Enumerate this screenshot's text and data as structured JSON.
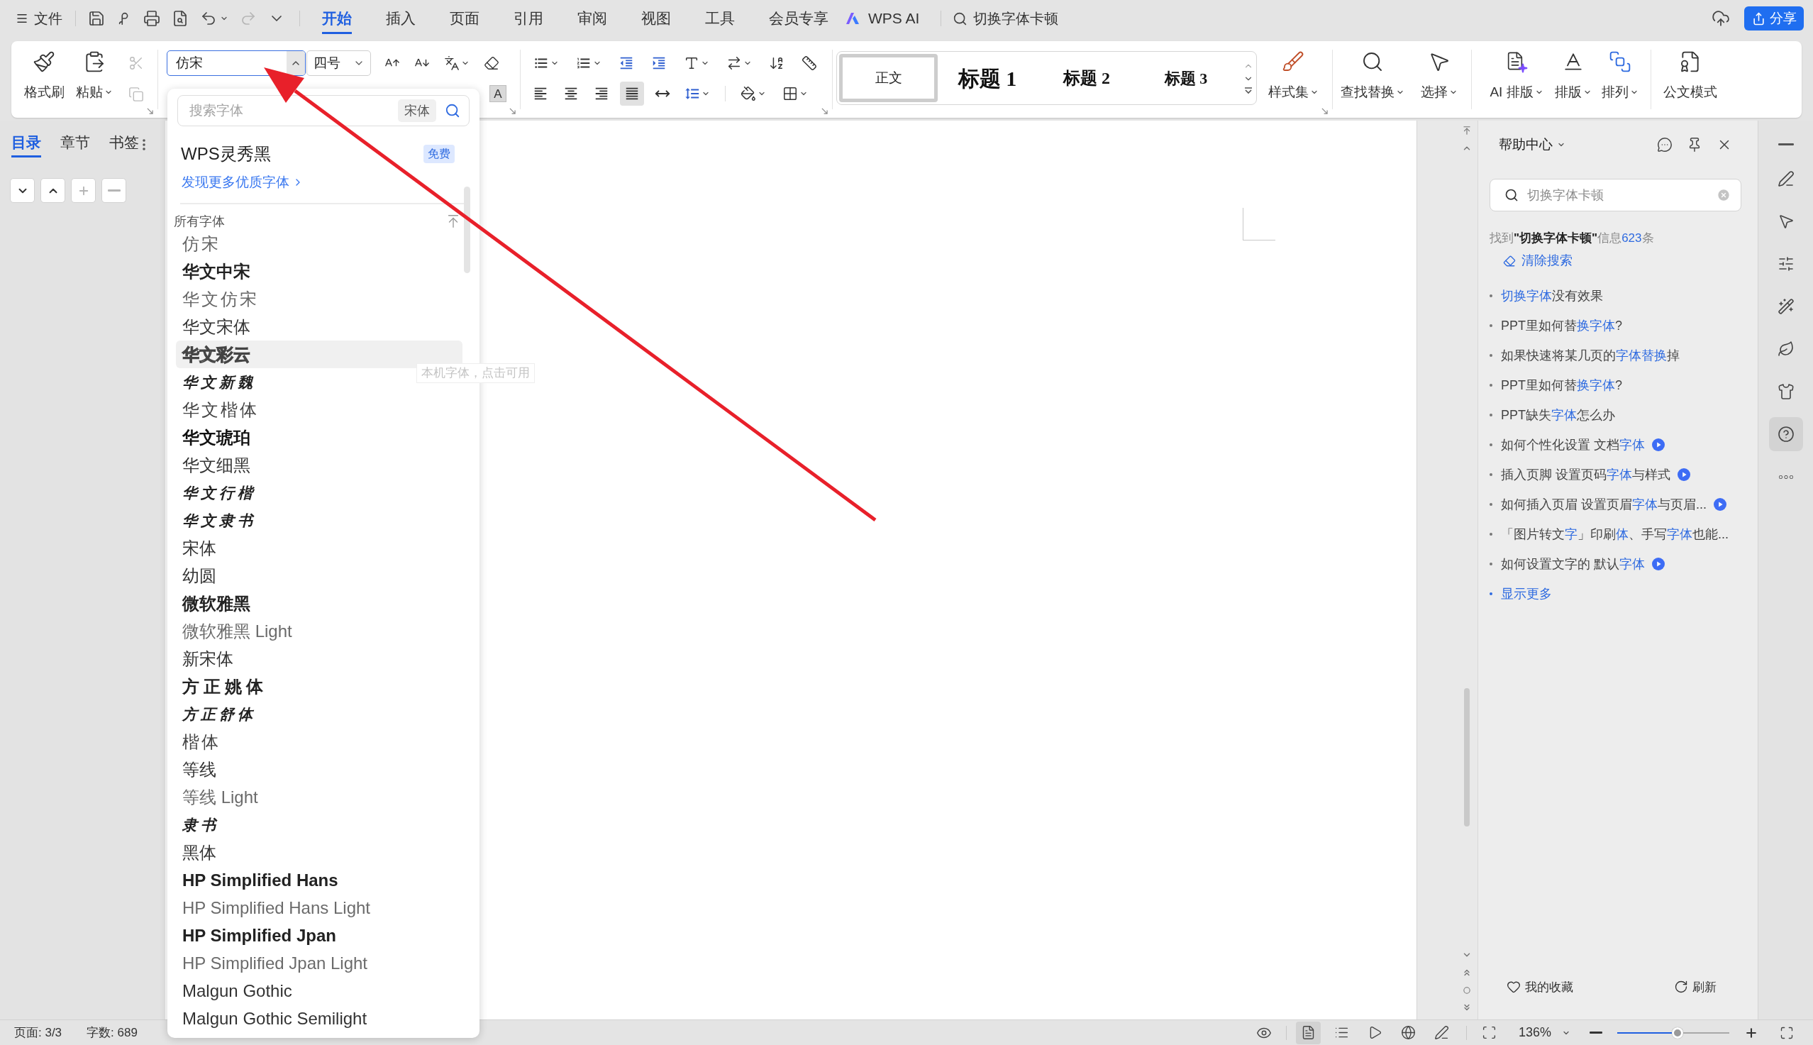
{
  "menu_bar": {
    "file_menu": "文件",
    "quick_access": [
      {
        "kind": "save",
        "disabled": false
      },
      {
        "kind": "export",
        "disabled": false
      },
      {
        "kind": "print",
        "disabled": false
      },
      {
        "kind": "preview",
        "disabled": false
      },
      {
        "kind": "undo",
        "disabled": false
      },
      {
        "kind": "redo",
        "disabled": true
      },
      {
        "kind": "more",
        "disabled": false
      }
    ],
    "tabs": [
      {
        "label": "开始",
        "selected": true
      },
      {
        "label": "插入",
        "selected": false
      },
      {
        "label": "页面",
        "selected": false
      },
      {
        "label": "引用",
        "selected": false
      },
      {
        "label": "审阅",
        "selected": false
      },
      {
        "label": "视图",
        "selected": false
      },
      {
        "label": "工具",
        "selected": false
      },
      {
        "label": "会员专享",
        "selected": false
      }
    ],
    "ai_tab": "WPS AI",
    "search": {
      "value": "切换字体卡顿"
    },
    "share_button": "分享"
  },
  "ribbon": {
    "clipboard": {
      "buttons": [
        {
          "kind": "format_painter",
          "label": "格式刷",
          "dropdown": false
        },
        {
          "kind": "paste",
          "label": "粘贴",
          "dropdown": true
        }
      ],
      "tools": [
        {
          "kind": "cut",
          "disabled": true
        },
        {
          "kind": "copy",
          "disabled": true
        }
      ]
    },
    "font": {
      "name": {
        "value": "仿宋",
        "expanded": true
      },
      "size": {
        "value": "四号"
      },
      "shading_label": "A"
    },
    "paragraph": {
      "align_buttons": [
        {
          "kind": "left",
          "selected": false
        },
        {
          "kind": "center",
          "selected": false
        },
        {
          "kind": "right",
          "selected": false
        },
        {
          "kind": "justify",
          "selected": true
        },
        {
          "kind": "distributed",
          "selected": false
        }
      ]
    },
    "styles": {
      "items": [
        {
          "kind": "body",
          "label": "正文",
          "selected": true
        },
        {
          "kind": "heading1",
          "label": "标题 1",
          "selected": false
        },
        {
          "kind": "heading2",
          "label": "标题 2",
          "selected": false
        },
        {
          "kind": "heading3",
          "label": "标题 3",
          "selected": false
        }
      ],
      "style_set": {
        "kind": "style_set",
        "label": "样式集",
        "dropdown": true
      }
    },
    "editing": [
      {
        "kind": "find_replace",
        "label": "查找替换",
        "dropdown": true
      },
      {
        "kind": "select",
        "label": "选择",
        "dropdown": true
      }
    ],
    "layout": [
      {
        "kind": "ai_layout",
        "label": "AI 排版",
        "dropdown": true
      },
      {
        "kind": "typesetting",
        "label": "排版",
        "dropdown": true
      },
      {
        "kind": "arrange",
        "label": "排列",
        "dropdown": true
      }
    ],
    "official": [
      {
        "kind": "official_mode",
        "label": "公文模式",
        "dropdown": false
      }
    ]
  },
  "sidebar": {
    "tabs": [
      {
        "label": "目录",
        "selected": true
      },
      {
        "label": "章节",
        "selected": false
      },
      {
        "label": "书签",
        "selected": false
      }
    ],
    "buttons": [
      {
        "kind": "collapse",
        "disabled": false
      },
      {
        "kind": "expand",
        "disabled": false
      },
      {
        "kind": "add",
        "disabled": true
      },
      {
        "kind": "remove",
        "disabled": true
      }
    ]
  },
  "font_dropdown": {
    "search": {
      "placeholder": "搜索字体"
    },
    "chip": "宋体",
    "featured": {
      "name": "WPS灵秀黑",
      "badge": "免费"
    },
    "discover_link": "发现更多优质字体",
    "section_title": "所有字体",
    "fonts": [
      {
        "name": "仿宋",
        "kind": "fangsong",
        "highlighted": false
      },
      {
        "name": "华文中宋",
        "kind": "song-bold",
        "highlighted": false
      },
      {
        "name": "华文仿宋",
        "kind": "fangsong",
        "highlighted": false
      },
      {
        "name": "华文宋体",
        "kind": "song",
        "highlighted": false
      },
      {
        "name": "华文彩云",
        "kind": "outline",
        "highlighted": true
      },
      {
        "name": "华文新魏",
        "kind": "calligraphy",
        "highlighted": false
      },
      {
        "name": "华文楷体",
        "kind": "kai",
        "highlighted": false
      },
      {
        "name": "华文琥珀",
        "kind": "heavy",
        "highlighted": false
      },
      {
        "name": "华文细黑",
        "kind": "sans",
        "highlighted": false
      },
      {
        "name": "华文行楷",
        "kind": "calligraphy",
        "highlighted": false
      },
      {
        "name": "华文隶书",
        "kind": "calligraphy",
        "highlighted": false
      },
      {
        "name": "宋体",
        "kind": "song",
        "highlighted": false
      },
      {
        "name": "幼圆",
        "kind": "sans",
        "highlighted": false
      },
      {
        "name": "微软雅黑",
        "kind": "sans-bold",
        "highlighted": false
      },
      {
        "name": "微软雅黑 Light",
        "kind": "sans-light",
        "highlighted": false
      },
      {
        "name": "新宋体",
        "kind": "sans",
        "highlighted": false
      },
      {
        "name": "方正姚体",
        "kind": "kai-bold",
        "highlighted": false
      },
      {
        "name": "方正舒体",
        "kind": "calligraphy",
        "highlighted": false
      },
      {
        "name": "楷体",
        "kind": "kai",
        "highlighted": false
      },
      {
        "name": "等线",
        "kind": "sans",
        "highlighted": false
      },
      {
        "name": "等线 Light",
        "kind": "sans-light",
        "highlighted": false
      },
      {
        "name": "隶书",
        "kind": "calligraphy",
        "highlighted": false
      },
      {
        "name": "黑体",
        "kind": "sans",
        "highlighted": false
      },
      {
        "name": "HP Simplified Hans",
        "kind": "sans-bold",
        "highlighted": false
      },
      {
        "name": "HP Simplified Hans Light",
        "kind": "sans-light",
        "highlighted": false
      },
      {
        "name": "HP Simplified Jpan",
        "kind": "sans-bold",
        "highlighted": false
      },
      {
        "name": "HP Simplified Jpan Light",
        "kind": "sans-light",
        "highlighted": false
      },
      {
        "name": "Malgun Gothic",
        "kind": "sans",
        "highlighted": false
      },
      {
        "name": "Malgun Gothic Semilight",
        "kind": "sans",
        "highlighted": false
      }
    ],
    "tooltip": "本机字体，点击可用"
  },
  "help_panel": {
    "title": "帮助中心",
    "search": {
      "value": "切换字体卡顿"
    },
    "result": [
      {
        "text": "找到",
        "kind": "muted"
      },
      {
        "text": "\"切换字体卡顿\"",
        "kind": "query"
      },
      {
        "text": "信息",
        "kind": "muted"
      },
      {
        "text": "623",
        "kind": "count"
      },
      {
        "text": "条",
        "kind": "muted"
      }
    ],
    "clear_search": "清除搜索",
    "articles": [
      {
        "segments": [
          {
            "text": "切换字体",
            "kind": "keyword"
          },
          {
            "text": "没有效果",
            "kind": "plain"
          }
        ],
        "video": false
      },
      {
        "segments": [
          {
            "text": "PPT里如何替",
            "kind": "plain"
          },
          {
            "text": "换字体",
            "kind": "keyword"
          },
          {
            "text": "?",
            "kind": "plain"
          }
        ],
        "video": false
      },
      {
        "segments": [
          {
            "text": "如果快速将某几页的",
            "kind": "plain"
          },
          {
            "text": "字体替换",
            "kind": "keyword"
          },
          {
            "text": "掉",
            "kind": "plain"
          }
        ],
        "video": false
      },
      {
        "segments": [
          {
            "text": "PPT里如何替",
            "kind": "plain"
          },
          {
            "text": "换字体",
            "kind": "keyword"
          },
          {
            "text": "?",
            "kind": "plain"
          }
        ],
        "video": false
      },
      {
        "segments": [
          {
            "text": "PPT缺失",
            "kind": "plain"
          },
          {
            "text": "字体",
            "kind": "keyword"
          },
          {
            "text": "怎么办",
            "kind": "plain"
          }
        ],
        "video": false
      },
      {
        "segments": [
          {
            "text": "如何个性化设置 文档",
            "kind": "plain"
          },
          {
            "text": "字体",
            "kind": "keyword"
          }
        ],
        "video": true
      },
      {
        "segments": [
          {
            "text": "插入页脚 设置页码",
            "kind": "plain"
          },
          {
            "text": "字体",
            "kind": "keyword"
          },
          {
            "text": "与样式",
            "kind": "plain"
          }
        ],
        "video": true
      },
      {
        "segments": [
          {
            "text": "如何插入页眉 设置页眉",
            "kind": "plain"
          },
          {
            "text": "字体",
            "kind": "keyword"
          },
          {
            "text": "与页眉...",
            "kind": "plain"
          }
        ],
        "video": true
      },
      {
        "segments": [
          {
            "text": "「图片转文",
            "kind": "plain"
          },
          {
            "text": "字",
            "kind": "keyword"
          },
          {
            "text": "」印刷",
            "kind": "plain"
          },
          {
            "text": "体",
            "kind": "keyword"
          },
          {
            "text": "、手写",
            "kind": "plain"
          },
          {
            "text": "字体",
            "kind": "keyword"
          },
          {
            "text": "也能...",
            "kind": "plain"
          }
        ],
        "video": false
      },
      {
        "segments": [
          {
            "text": "如何设置文字的 默认",
            "kind": "plain"
          },
          {
            "text": "字体",
            "kind": "keyword"
          }
        ],
        "video": true
      }
    ],
    "show_more": "显示更多",
    "favorites": "我的收藏",
    "refresh": "刷新"
  },
  "side_tools": [
    {
      "kind": "collapse",
      "selected": false
    },
    {
      "kind": "edit",
      "selected": false
    },
    {
      "kind": "select",
      "selected": false
    },
    {
      "kind": "adjust",
      "selected": false
    },
    {
      "kind": "tools",
      "selected": false
    },
    {
      "kind": "theme",
      "selected": false
    },
    {
      "kind": "outfit",
      "selected": false
    },
    {
      "kind": "help",
      "selected": true
    },
    {
      "kind": "more",
      "selected": false
    }
  ],
  "status_bar": {
    "page": "页面: 3/3",
    "word_count": "字数: 689",
    "view_buttons": [
      {
        "kind": "page",
        "selected": true
      },
      {
        "kind": "outline",
        "selected": false
      },
      {
        "kind": "present",
        "selected": false
      },
      {
        "kind": "web",
        "selected": false
      },
      {
        "kind": "annotate",
        "selected": false
      }
    ],
    "zoom": "136%",
    "zoom_slider": {
      "level": 0.54
    }
  }
}
